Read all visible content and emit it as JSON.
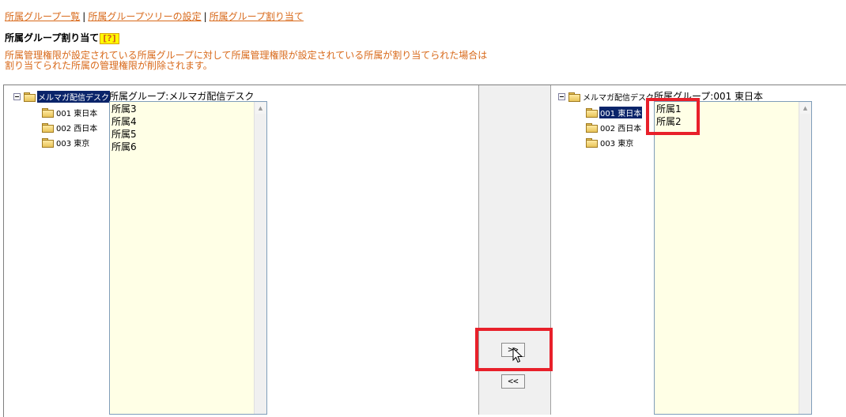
{
  "nav": {
    "links": [
      "所属グループ一覧",
      "所属グループツリーの設定",
      "所属グループ割り当て"
    ],
    "separator": "|"
  },
  "page": {
    "title": "所属グループ割り当て",
    "help_label": "[?]",
    "notice": "所属管理権限が設定されている所属グループに対して所属管理権限が設定されている所属が割り当てられた場合は\n割り当てられた所属の管理権限が削除されます。"
  },
  "left": {
    "tree": {
      "root": "メルマガ配信デスク",
      "children": [
        "001 東日本",
        "002 西日本",
        "003 東京"
      ]
    },
    "group_title": "所属グループ:メルマガ配信デスク",
    "list_items": [
      "所属3",
      "所属4",
      "所属5",
      "所属6"
    ]
  },
  "middle": {
    "assign_label": ">>",
    "remove_label": "<<"
  },
  "right": {
    "tree": {
      "root": "メルマガ配信デスク",
      "children": [
        "001 東日本",
        "002 西日本",
        "003 東京"
      ]
    },
    "group_title": "所属グループ:001 東日本",
    "list_items": [
      "所属1",
      "所属2"
    ]
  },
  "colors": {
    "link": "#d8691a",
    "listbox_bg": "#ffffe6",
    "selected_bg": "#0a246a",
    "highlight": "#e8202a"
  }
}
